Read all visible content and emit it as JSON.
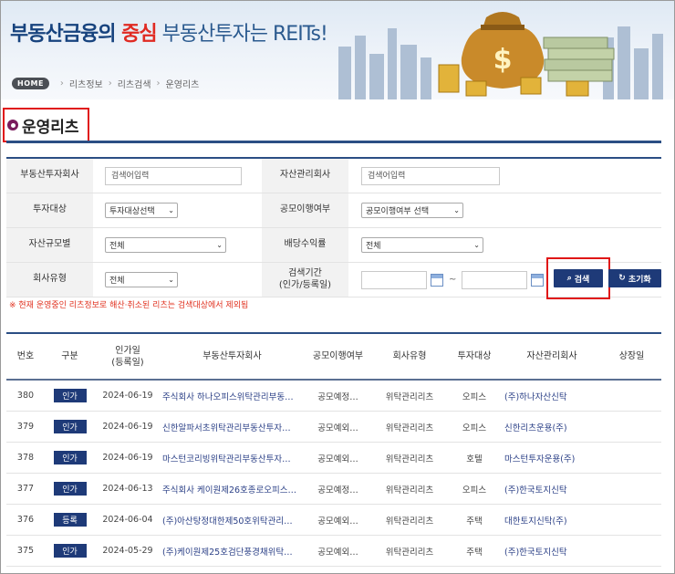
{
  "banner": {
    "slogan_part1": "부동산금융의 ",
    "slogan_part2": "중심",
    "slogan_part3": " 부동산투자는 REITs!"
  },
  "breadcrumb": {
    "home": "HOME",
    "items": [
      "리츠정보",
      "리츠검색",
      "운영리츠"
    ]
  },
  "page": {
    "title": "운영리츠"
  },
  "form": {
    "reit_company_label": "부동산투자회사",
    "reit_company_placeholder": "검색어입력",
    "asset_mgr_label": "자산관리회사",
    "asset_mgr_placeholder": "검색어입력",
    "invest_target_label": "투자대상",
    "invest_target_value": "투자대상선택",
    "public_offer_label": "공모이행여부",
    "public_offer_value": "공모이행여부 선택",
    "asset_size_label": "자산규모별",
    "asset_size_value": "전체",
    "dividend_label": "배당수익률",
    "dividend_value": "전체",
    "company_type_label": "회사유형",
    "company_type_value": "전체",
    "period_label_1": "검색기간",
    "period_label_2": "(인가/등록일)",
    "tilde": "~",
    "search_label": "검색",
    "reset_label": "초기화"
  },
  "notice": "※ 현재 운영중인 리츠정보로 해산·취소된 리츠는 검색대상에서 제외됨",
  "table": {
    "headers": {
      "no": "번호",
      "type": "구분",
      "date_1": "인가일",
      "date_2": "(등록일)",
      "company": "부동산투자회사",
      "public_offer": "공모이행여부",
      "company_type": "회사유형",
      "target": "투자대상",
      "asset_mgr": "자산관리회사",
      "listing_date": "상장일"
    },
    "rows": [
      {
        "no": "380",
        "type": "인가",
        "date": "2024-06-19",
        "company": "주식회사 하나오피스위탁관리부동…",
        "public_offer": "공모예정…",
        "company_type": "위탁관리리츠",
        "target": "오피스",
        "asset_mgr": "(주)하나자산신탁",
        "listing_date": ""
      },
      {
        "no": "379",
        "type": "인가",
        "date": "2024-06-19",
        "company": "신한알파서초위탁관리부동산투자…",
        "public_offer": "공모예외…",
        "company_type": "위탁관리리츠",
        "target": "오피스",
        "asset_mgr": "신한리츠운용(주)",
        "listing_date": ""
      },
      {
        "no": "378",
        "type": "인가",
        "date": "2024-06-19",
        "company": "마스턴코리빙위탁관리부동산투자…",
        "public_offer": "공모예외…",
        "company_type": "위탁관리리츠",
        "target": "호텔",
        "asset_mgr": "마스턴투자운용(주)",
        "listing_date": ""
      },
      {
        "no": "377",
        "type": "인가",
        "date": "2024-06-13",
        "company": "주식회사 케이원제26호종로오피스…",
        "public_offer": "공모예정…",
        "company_type": "위탁관리리츠",
        "target": "오피스",
        "asset_mgr": "(주)한국토지신탁",
        "listing_date": ""
      },
      {
        "no": "376",
        "type": "등록",
        "date": "2024-06-04",
        "company": "(주)아산탕정대한제50호위탁관리…",
        "public_offer": "공모예외…",
        "company_type": "위탁관리리츠",
        "target": "주택",
        "asset_mgr": "대한토지신탁(주)",
        "listing_date": ""
      },
      {
        "no": "375",
        "type": "인가",
        "date": "2024-05-29",
        "company": "(주)케이원제25호검단풍경채위탁…",
        "public_offer": "공모예외…",
        "company_type": "위탁관리리츠",
        "target": "주택",
        "asset_mgr": "(주)한국토지신탁",
        "listing_date": ""
      }
    ]
  },
  "colors": {
    "navy": "#1e3a78",
    "title_line": "#2b4e84",
    "highlight": "#e01717",
    "slogan_accent": "#e02a22",
    "notice": "#e0301e"
  }
}
